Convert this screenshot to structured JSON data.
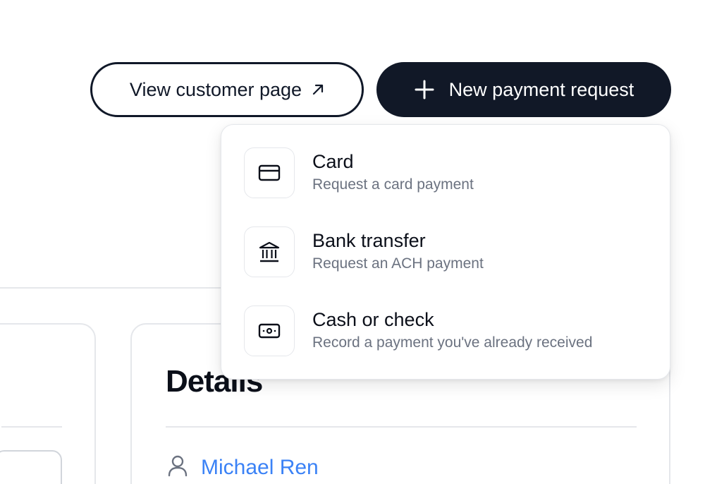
{
  "header": {
    "view_customer_label": "View customer page",
    "new_request_label": "New payment request"
  },
  "menu": {
    "items": [
      {
        "label": "Card",
        "description": "Request a card payment",
        "icon": "credit-card-icon"
      },
      {
        "label": "Bank transfer",
        "description": "Request an ACH payment",
        "icon": "bank-icon"
      },
      {
        "label": "Cash or check",
        "description": "Record a payment you've already received",
        "icon": "cash-icon"
      }
    ]
  },
  "details": {
    "title": "Details",
    "contact_name": "Michael Ren"
  },
  "colors": {
    "primary_dark": "#111827",
    "link_blue": "#3b82f6",
    "muted_text": "#6b7280",
    "border": "#e5e7eb"
  }
}
